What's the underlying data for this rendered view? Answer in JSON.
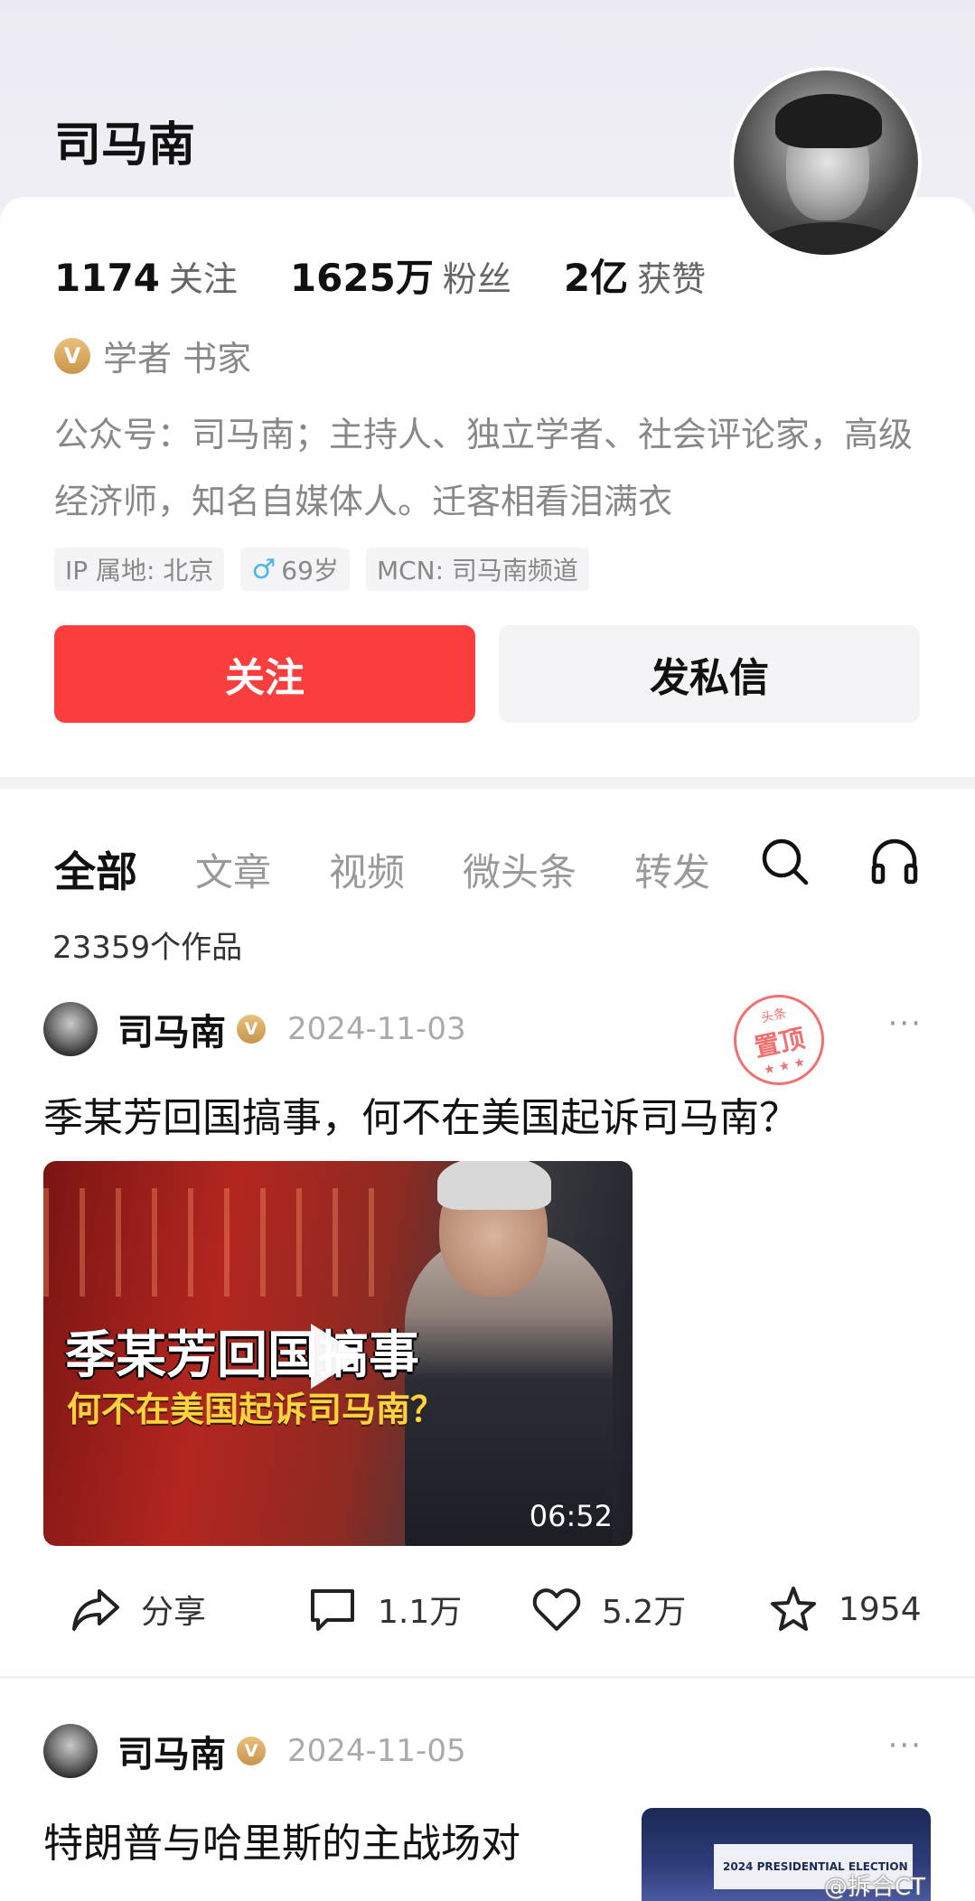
{
  "profile": {
    "name": "司马南",
    "stats": [
      {
        "num": "1174",
        "label": "关注"
      },
      {
        "num": "1625万",
        "label": "粉丝"
      },
      {
        "num": "2亿",
        "label": "获赞"
      }
    ],
    "verify_badge": "V",
    "verify_text": "学者 书家",
    "bio": "公众号：司马南；主持人、独立学者、社会评论家，高级经济师，知名自媒体人。迁客相看泪满衣",
    "tags": {
      "ip": "IP 属地: 北京",
      "gender_icon": "♂",
      "age": "69岁",
      "mcn": "MCN: 司马南频道"
    },
    "follow_label": "关注",
    "message_label": "发私信"
  },
  "feed": {
    "tabs": [
      "全部",
      "文章",
      "视频",
      "微头条",
      "转发"
    ],
    "works_count": "23359个作品",
    "icons": [
      "search-icon",
      "headphones-icon"
    ]
  },
  "post1": {
    "author": "司马南",
    "badge": "V",
    "date": "2024-11-03",
    "more": "···",
    "stamp_small": "头条",
    "stamp_big": "置顶",
    "stamp_dots": "★ ★ ★",
    "title": "季某芳回国搞事，何不在美国起诉司马南？",
    "video_line1": "季某芳回国搞事",
    "video_line2": "何不在美国起诉司马南？",
    "duration": "06:52",
    "actions": {
      "share": "分享",
      "comment": "1.1万",
      "like": "5.2万",
      "favorite": "1954"
    }
  },
  "post2": {
    "author": "司马南",
    "badge": "V",
    "date": "2024-11-05",
    "more": "···",
    "title": "特朗普与哈里斯的主战场对",
    "thumb_text": "2024 PRESIDENTIAL ELECTION"
  },
  "watermark": "@拆合CT",
  "colors": {
    "accent_red": "#fa3d3d",
    "verify_gold": "#d9a85e",
    "stamp_red": "#f26f6f"
  }
}
